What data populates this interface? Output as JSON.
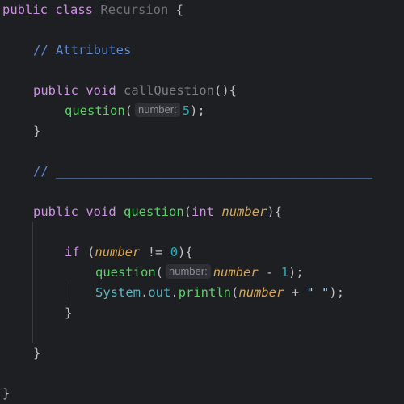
{
  "code": {
    "line_1": {
      "kw1": "public",
      "kw2": "class",
      "class_name": "Recursion",
      "brace": "{"
    },
    "line_2": {
      "comment": "// Attributes"
    },
    "line_3": {
      "kw1": "public",
      "kw2": "void",
      "method_name": "callQuestion",
      "sig": "(){"
    },
    "line_4": {
      "call": "question",
      "open": "(",
      "hint": "number:",
      "arg": "5",
      "close": ");"
    },
    "line_5": {
      "brace": "}"
    },
    "line_6": {
      "comment": "// __________________________________________"
    },
    "line_7": {
      "kw1": "public",
      "kw2": "void",
      "method_name": "question",
      "open": "(",
      "type": "int",
      "param": "number",
      "close": "){"
    },
    "line_8": {
      "kw": "if",
      "open": "(",
      "param": "number",
      "op": " != ",
      "num": "0",
      "close": "){"
    },
    "line_9": {
      "call": "question",
      "open": "(",
      "hint": "number:",
      "param": "number",
      "op": " - ",
      "num": "1",
      "close": ");"
    },
    "line_10": {
      "cls": "System",
      "dot1": ".",
      "field": "out",
      "dot2": ".",
      "method": "println",
      "open": "(",
      "param": "number",
      "op": " + ",
      "str": "\" \"",
      "close": ");"
    },
    "line_11": {
      "brace": "}"
    },
    "line_12": {
      "brace": "}"
    },
    "line_13": {
      "brace": "}"
    }
  },
  "colors": {
    "background": "#1e1f22",
    "keyword": "#cf8ee8",
    "function": "#56d364",
    "comment": "#5f8ad1",
    "number": "#2aacb8",
    "parameter": "#d6a658",
    "inlay_hint_bg": "#2f3035"
  }
}
